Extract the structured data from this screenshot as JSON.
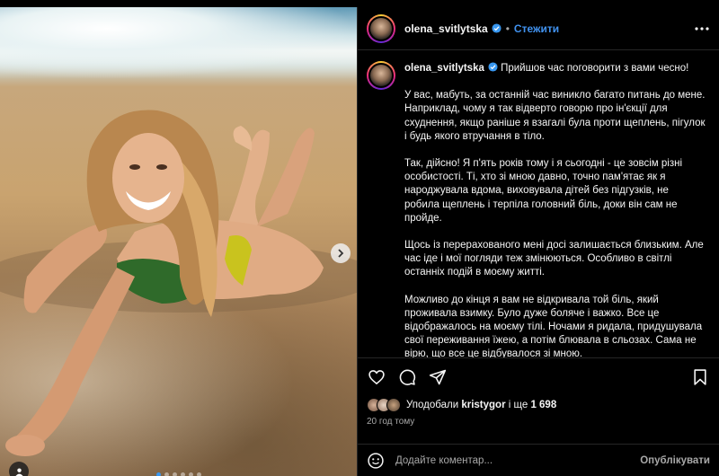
{
  "post": {
    "username": "olena_svitlytska",
    "follow_label": "Стежити",
    "separator": "•"
  },
  "caption": {
    "username": "olena_svitlytska",
    "paragraphs": [
      "Прийшов час поговорити з вами чесно!",
      "У вас, мабуть, за останній час виникло багато питань до мене. Наприклад, чому я так відверто говорю про ін'єкції для схуднення, якщо раніше я взагалі була проти щеплень, пігулок і будь якого втручання в тіло.",
      "Так, дійсно! Я п'ять років тому і я сьогодні - це зовсім різні особистості. Ті, хто зі мною давно, точно пам'ятає як я народжувала вдома, виховувала дітей без підгузків, не робила щеплень і терпіла головний біль, доки він сам не пройде.",
      "Щось із перерахованого мені досі залишається близьким. Але час іде і мої погляди теж змінюються. Особливо в світлі останніх подій в моєму житті.",
      "Можливо до кінця я вам не відкривала той біль, який проживала взимку. Було дуже боляче і важко. Все це відображалось на моєму тілі. Ночами я ридала, придушувала свої переживання їжею, а потім блювала в сльозах. Сама не вірю, що все це відбувалося зі мною."
    ]
  },
  "likes": {
    "prefix": "Уподобали",
    "user": "kristygor",
    "middle": "і ще",
    "count": "1 698"
  },
  "timestamp": "20 год тому",
  "comment": {
    "placeholder": "Додайте коментар...",
    "post_label": "Опублікувати"
  },
  "carousel": {
    "slides": 6,
    "active_index": 0
  },
  "colors": {
    "accent": "#4192ef",
    "verified": "#3897f0",
    "background": "#000000"
  },
  "icons": {
    "header_more": "more-icon",
    "verified": "verified-badge-icon",
    "like": "heart-icon",
    "comment": "comment-icon",
    "share": "share-icon",
    "save": "bookmark-icon",
    "emoji": "emoji-icon",
    "next": "chevron-right-icon",
    "tags": "user-tag-icon"
  }
}
